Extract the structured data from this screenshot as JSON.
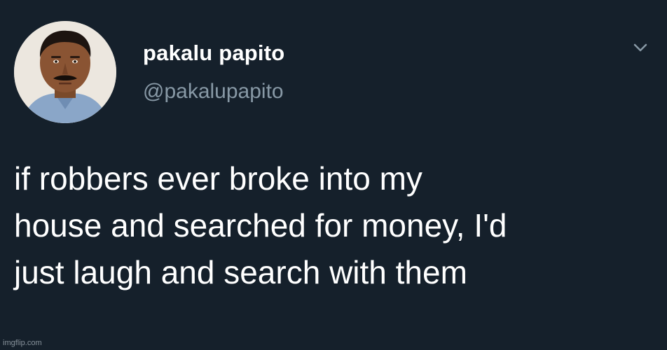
{
  "author": {
    "display_name": "pakalu papito",
    "handle": "@pakalupapito",
    "avatar_icon": "profile-photo"
  },
  "menu": {
    "icon": "chevron-down-icon"
  },
  "tweet": {
    "lines": [
      "if robbers ever broke into my",
      "house and searched for money, I'd",
      "just laugh and search with them"
    ]
  },
  "watermark": "imgflip.com",
  "colors": {
    "background": "#15202b",
    "text": "#ffffff",
    "secondary_text": "#8899a6"
  }
}
